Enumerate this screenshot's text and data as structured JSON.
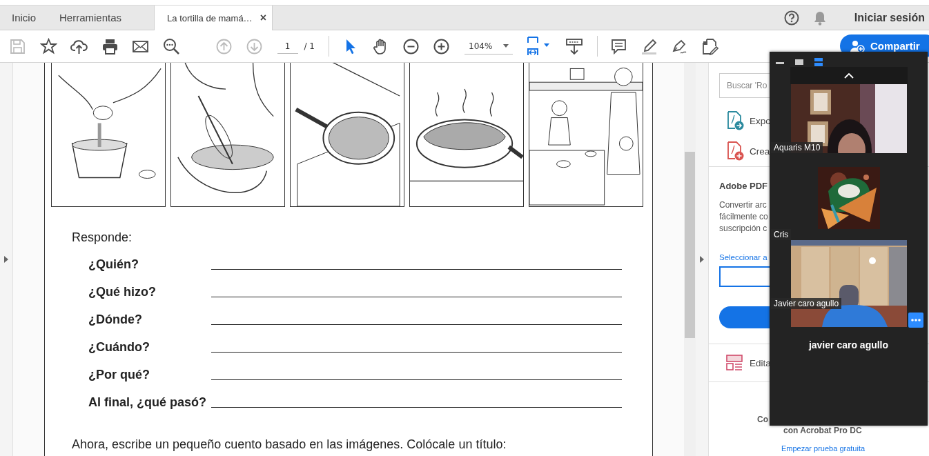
{
  "tabs": [
    {
      "label": "Inicio",
      "selected": false
    },
    {
      "label": "Herramientas",
      "selected": false
    },
    {
      "label": "La tortilla de mamá…",
      "selected": true,
      "close": "×"
    }
  ],
  "header": {
    "sign_in": "Iniciar sesión"
  },
  "toolbar": {
    "left": [
      {
        "kind": "save",
        "disabled": true
      },
      {
        "kind": "star",
        "disabled": false
      },
      {
        "kind": "upload",
        "disabled": false
      },
      {
        "kind": "print",
        "disabled": false
      },
      {
        "kind": "mail",
        "disabled": false
      },
      {
        "kind": "search",
        "disabled": false
      }
    ],
    "nav": [
      {
        "kind": "up",
        "disabled": true
      },
      {
        "kind": "down",
        "disabled": true
      }
    ],
    "page_current": "1",
    "page_total": "/ 1",
    "tools": [
      {
        "kind": "select",
        "selected": true
      },
      {
        "kind": "hand",
        "selected": false
      },
      {
        "kind": "zoomout",
        "selected": false
      },
      {
        "kind": "zoomin",
        "selected": false
      }
    ],
    "zoom": "104%",
    "right": [
      {
        "kind": "comment"
      },
      {
        "kind": "highlight"
      },
      {
        "kind": "sign"
      },
      {
        "kind": "editdoc"
      }
    ],
    "share": "Compartir"
  },
  "document": {
    "prompt": "Responde:",
    "questions": [
      "¿Quién?",
      "¿Qué hizo?",
      "¿Dónde?",
      "¿Cuándo?",
      "¿Por qué?",
      "Al final, ¿qué pasó?"
    ],
    "instruction": "Ahora, escribe un pequeño cuento basado en las imágenes. Colócale un título:"
  },
  "right_panel": {
    "search_placeholder": "Buscar 'Ro",
    "tools": [
      {
        "kind": "export",
        "label": "Expo"
      },
      {
        "kind": "create",
        "label": "Crea"
      }
    ],
    "promo": {
      "title": "Adobe PDF",
      "lines": [
        "Convertir arc",
        "fácilmente co",
        "suscripción c"
      ],
      "link": "Seleccionar a"
    },
    "edit_tool": {
      "kind": "edit",
      "label": "Edita"
    },
    "footer": {
      "line1": "Co",
      "line2": "con Acrobat Pro DC",
      "link": "Empezar prueba gratuita"
    }
  },
  "video_call": {
    "views": [
      {
        "kind": "minimize",
        "selected": false
      },
      {
        "kind": "single",
        "selected": false
      },
      {
        "kind": "stacked",
        "selected": true
      }
    ],
    "participants": [
      {
        "kind": "camera",
        "name": "Aquaris M10"
      },
      {
        "kind": "avatar",
        "name": "Cris"
      },
      {
        "kind": "camera",
        "name": "Javier caro agullo"
      }
    ],
    "speaker": "javier caro agullo"
  }
}
